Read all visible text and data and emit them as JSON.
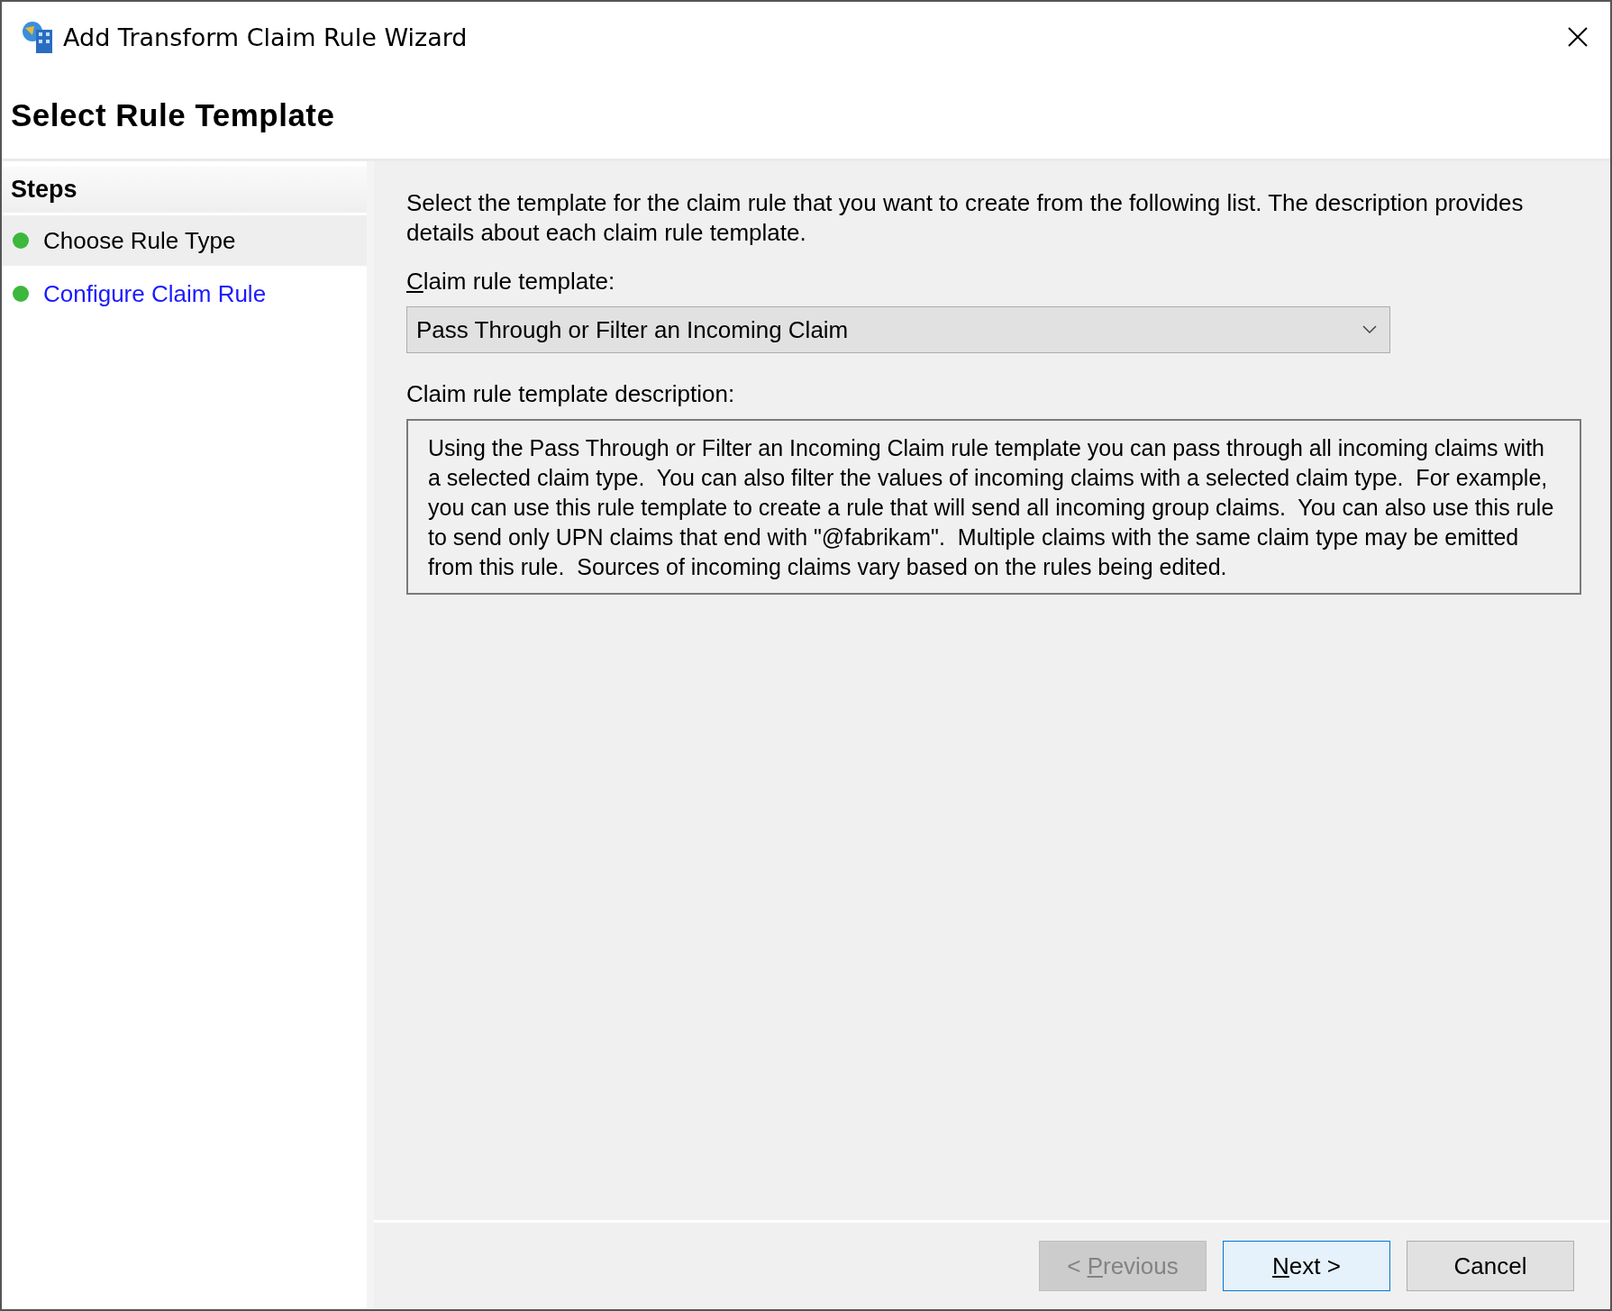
{
  "window": {
    "title": "Add Transform Claim Rule Wizard"
  },
  "page_title": "Select Rule Template",
  "steps": {
    "header": "Steps",
    "items": [
      {
        "label": "Choose Rule Type",
        "selected": true,
        "kind": "text",
        "color": "#3cb83c"
      },
      {
        "label": "Configure Claim Rule",
        "selected": false,
        "kind": "link",
        "color": "#3cb83c"
      }
    ]
  },
  "intro": "Select the template for the claim rule that you want to create from the following list. The description provides details about each claim rule template.",
  "template_field": {
    "label": "Claim rule template:",
    "mnemonic_underlined": true,
    "value": "Pass Through or Filter an Incoming Claim"
  },
  "description": {
    "label": "Claim rule template description:",
    "text": "Using the Pass Through or Filter an Incoming Claim rule template you can pass through all incoming claims with a selected claim type.  You can also filter the values of incoming claims with a selected claim type.  For example, you can use this rule template to create a rule that will send all incoming group claims.  You can also use this rule to send only UPN claims that end with \"@fabrikam\".  Multiple claims with the same claim type may be emitted from this rule.  Sources of incoming claims vary based on the rules being edited."
  },
  "buttons": [
    {
      "label": "< Previous",
      "mnemonic_underlined": true,
      "disabled": true,
      "focused": false
    },
    {
      "label": "Next >",
      "mnemonic_underlined": true,
      "disabled": false,
      "focused": true
    },
    {
      "label": "Cancel",
      "mnemonic_underlined": false,
      "disabled": false,
      "focused": false
    }
  ]
}
